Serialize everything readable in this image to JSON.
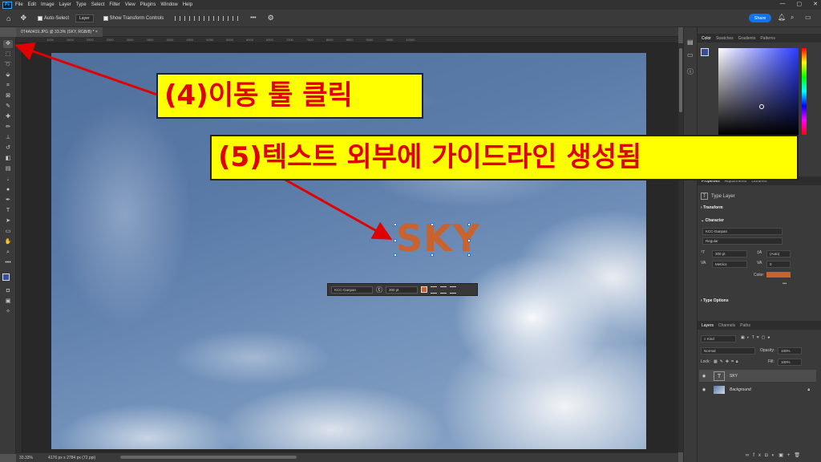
{
  "app": {
    "logo": "Ps"
  },
  "menu": [
    "File",
    "Edit",
    "Image",
    "Layer",
    "Type",
    "Select",
    "Filter",
    "View",
    "Plugins",
    "Window",
    "Help"
  ],
  "window_controls": [
    "—",
    "▢",
    "✕"
  ],
  "options_bar": {
    "auto_select_label": "Auto-Select",
    "auto_select_value": "Layer",
    "transform_label": "Show Transform Controls",
    "more": "•••",
    "share_label": "Share"
  },
  "document": {
    "tab_title": "0T4A0419.JPG @ 33.3% (SKY, RGB/8) *",
    "canvas_text": "SKY"
  },
  "ruler_ticks": [
    "1000",
    "1500",
    "2000",
    "2500",
    "3000",
    "3500",
    "4000",
    "4500",
    "5000",
    "5500",
    "6000",
    "6500",
    "7000",
    "7500",
    "8000",
    "8500",
    "9000",
    "9500",
    "10000"
  ],
  "context_bar": {
    "font": "KCC-Ganpan",
    "size": "300 pt",
    "text_color": "#c8622e"
  },
  "status": {
    "zoom": "33.33%",
    "doc_info": "4176 px x 2784 px (72 ppi)"
  },
  "panels": {
    "color_tabs": [
      "Color",
      "Swatches",
      "Gradients",
      "Patterns"
    ],
    "properties_tabs": [
      "Properties",
      "Adjustments",
      "Libraries"
    ],
    "properties": {
      "layer_type": "Type Layer",
      "transform": "Transform",
      "character": "Character",
      "font": "KCC-Ganpan",
      "style": "Regular",
      "size": "300 pt",
      "leading": "(Auto)",
      "kerning": "Metrics",
      "tracking": "0",
      "color_label": "Color:",
      "color_value": "#c8622e",
      "type_options": "Type Options"
    },
    "layers_tabs": [
      "Layers",
      "Channels",
      "Paths"
    ],
    "layers": {
      "filter_kind": "Kind",
      "blend_mode": "Normal",
      "opacity_label": "Opacity:",
      "opacity": "100%",
      "lock_label": "Lock:",
      "fill_label": "Fill:",
      "fill": "100%",
      "items": [
        {
          "name": "SKY",
          "type": "text"
        },
        {
          "name": "Background",
          "type": "image"
        }
      ]
    }
  },
  "annotations": {
    "callout1": "(4)이동 툴 클릭",
    "callout2": "(5)텍스트 외부에 가이드라인 생성됨"
  }
}
